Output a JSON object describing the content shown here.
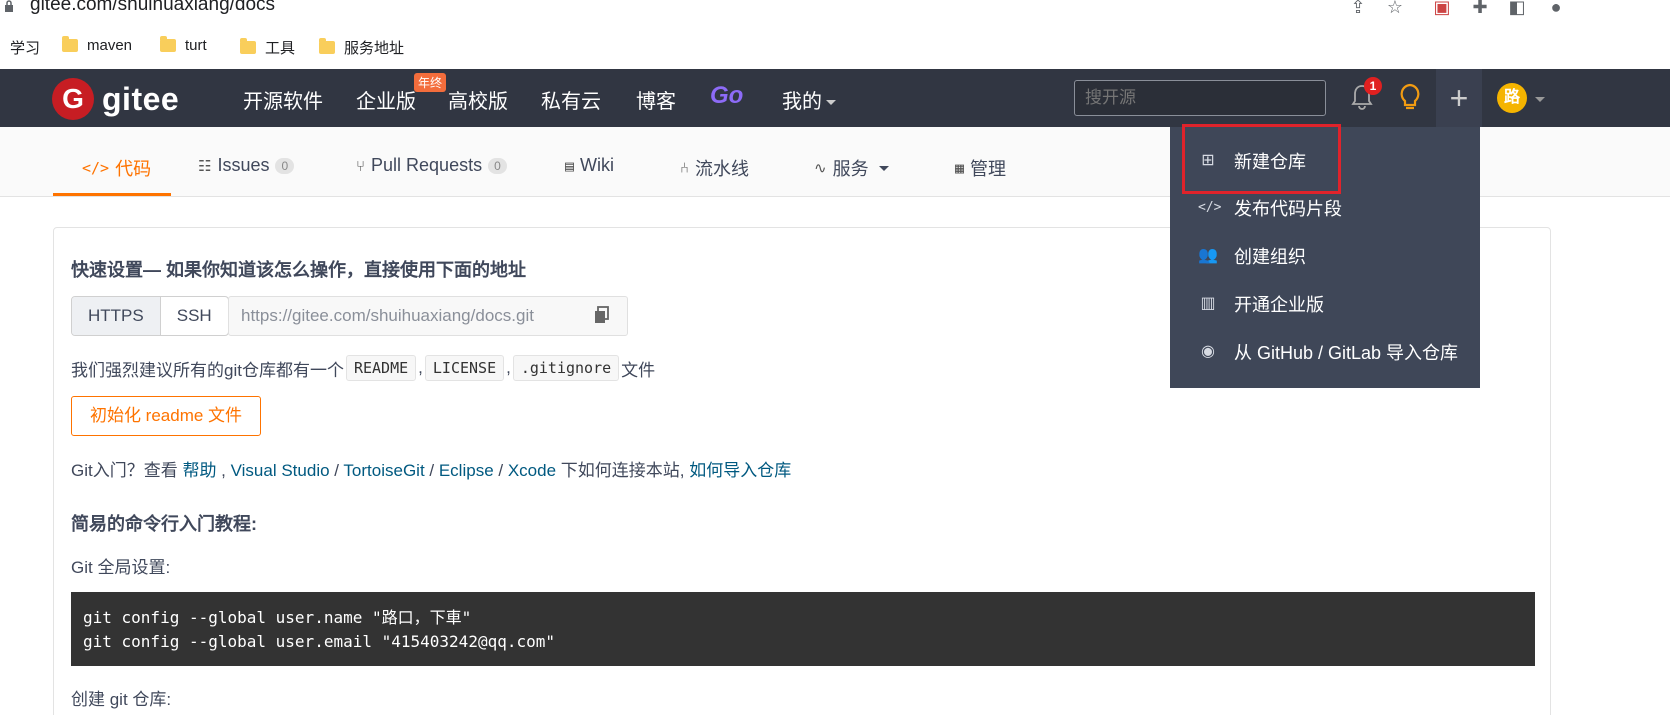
{
  "browser": {
    "url": "gitee.com/shuihuaxiang/docs",
    "bookmarks": [
      "学习",
      "maven",
      "turt",
      "工具",
      "服务地址"
    ]
  },
  "topnav": {
    "logo_text": "gitee",
    "items": [
      "开源软件",
      "企业版",
      "高校版",
      "私有云",
      "博客",
      "Go",
      "我的"
    ],
    "year_badge": "年终",
    "search_placeholder": "搜开源",
    "notification_count": "1",
    "avatar_text": "路"
  },
  "tabs": [
    {
      "label": "代码",
      "active": true
    },
    {
      "label": "Issues",
      "count": "0"
    },
    {
      "label": "Pull Requests",
      "count": "0"
    },
    {
      "label": "Wiki"
    },
    {
      "label": "流水线"
    },
    {
      "label": "服务"
    },
    {
      "label": "管理"
    }
  ],
  "quick_setup": {
    "heading": "快速设置— 如果你知道该怎么操作，直接使用下面的地址",
    "protocols": [
      "HTTPS",
      "SSH"
    ],
    "clone_url": "https://gitee.com/shuihuaxiang/docs.git",
    "suggest_prefix": "我们强烈建议所有的git仓库都有一个",
    "suggest_files": [
      "README",
      "LICENSE",
      ".gitignore"
    ],
    "suggest_suffix": "文件",
    "init_button": "初始化 readme 文件",
    "help_prefix": "Git入门？查看 ",
    "help_link": "帮助",
    "help_tools": [
      "Visual Studio",
      "TortoiseGit",
      "Eclipse",
      "Xcode"
    ],
    "help_mid": " 下如何连接本站,",
    "help_import": "如何导入仓库"
  },
  "cli": {
    "heading": "简易的命令行入门教程:",
    "global_label": "Git 全局设置:",
    "code_line1": "git config --global user.name \"路口，下車\"",
    "code_line2": "git config --global user.email \"415403242@qq.com\"",
    "create_label": "创建 git 仓库:"
  },
  "dropdown": {
    "items": [
      "新建仓库",
      "发布代码片段",
      "创建组织",
      "开通企业版",
      "从 GitHub / GitLab 导入仓库"
    ]
  }
}
